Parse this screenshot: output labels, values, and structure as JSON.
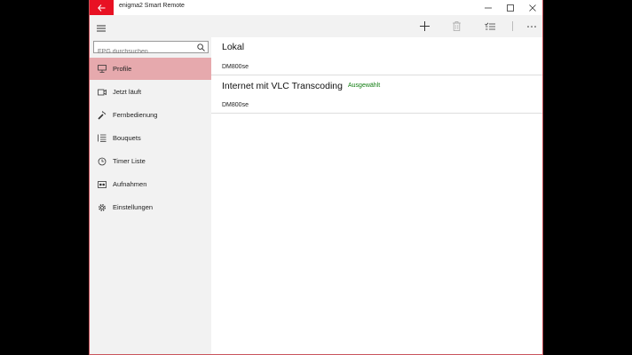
{
  "window": {
    "title": "enigma2 Smart Remote",
    "accent": "#e81123"
  },
  "search": {
    "placeholder": "EPG durchsuchen"
  },
  "sidebar": {
    "items": [
      {
        "label": "Profile",
        "icon": "monitor-icon",
        "active": true
      },
      {
        "label": "Jetzt läuft",
        "icon": "video-icon",
        "active": false
      },
      {
        "label": "Fernbedienung",
        "icon": "remote-icon",
        "active": false
      },
      {
        "label": "Bouquets",
        "icon": "list-icon",
        "active": false
      },
      {
        "label": "Timer Liste",
        "icon": "clock-icon",
        "active": false
      },
      {
        "label": "Aufnahmen",
        "icon": "recording-icon",
        "active": false
      },
      {
        "label": "Einstellungen",
        "icon": "gear-icon",
        "active": false
      }
    ]
  },
  "commandbar": {
    "icons": [
      "add-icon",
      "delete-icon",
      "select-icon",
      "more-icon"
    ]
  },
  "profiles": [
    {
      "name": "Lokal",
      "device": "DM800se",
      "status": ""
    },
    {
      "name": "Internet mit VLC Transcoding",
      "device": "DM800se",
      "status": "Ausgewählt"
    }
  ]
}
